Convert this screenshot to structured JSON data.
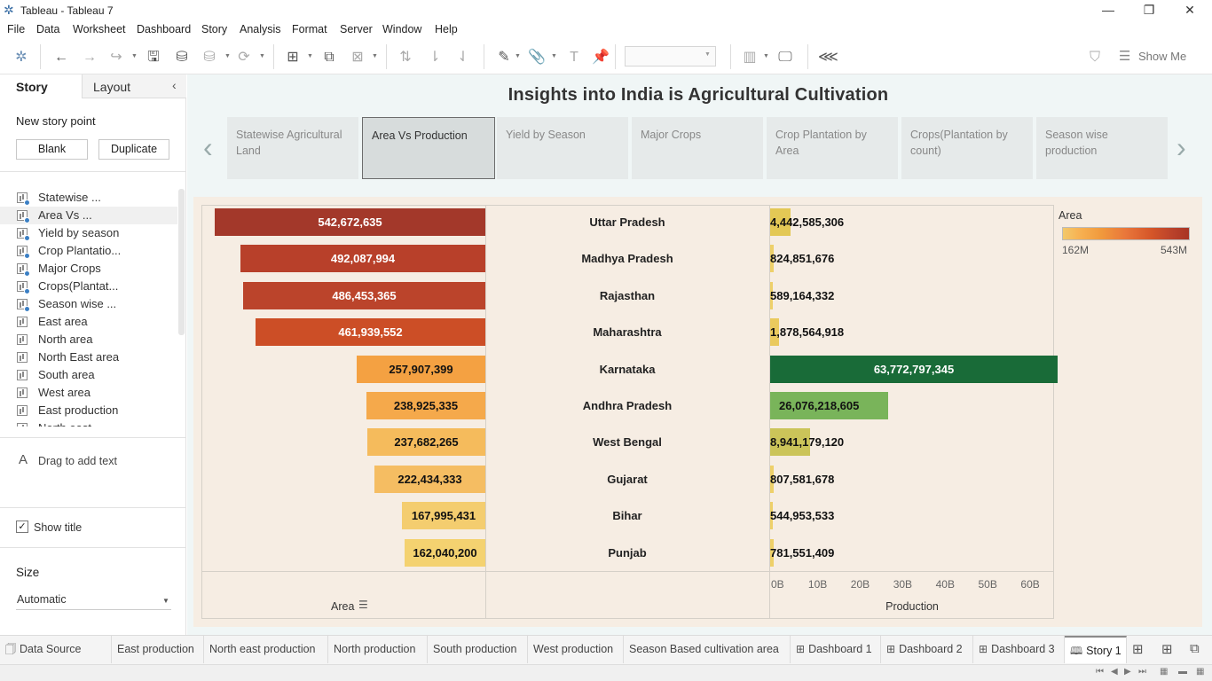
{
  "window": {
    "title": "Tableau - Tableau 7",
    "minimize": "—",
    "maximize": "❐",
    "close": "✕"
  },
  "menu": [
    "File",
    "Data",
    "Worksheet",
    "Dashboard",
    "Story",
    "Analysis",
    "Format",
    "Server",
    "Window",
    "Help"
  ],
  "toolbar": {
    "show_me": "Show Me"
  },
  "sidebar": {
    "tab_story": "Story",
    "tab_layout": "Layout",
    "new_story_point": "New story point",
    "blank_button": "Blank",
    "duplicate_button": "Duplicate",
    "sheets": [
      {
        "label": "Statewise ...",
        "used": true
      },
      {
        "label": "Area Vs ...",
        "used": true
      },
      {
        "label": "Yield by season",
        "used": true
      },
      {
        "label": "Crop Plantatio...",
        "used": true
      },
      {
        "label": "Major Crops",
        "used": true
      },
      {
        "label": "Crops(Plantat...",
        "used": true
      },
      {
        "label": "Season wise ...",
        "used": true
      },
      {
        "label": "East area",
        "used": false
      },
      {
        "label": "North area",
        "used": false
      },
      {
        "label": "North East area",
        "used": false
      },
      {
        "label": "South area",
        "used": false
      },
      {
        "label": "West area",
        "used": false
      },
      {
        "label": "East production",
        "used": false
      },
      {
        "label": "North east ...",
        "used": false
      }
    ],
    "drag_text": "Drag to add text",
    "show_title": "Show title",
    "size_heading": "Size",
    "size_value": "Automatic"
  },
  "story": {
    "title": "Insights into India is Agricultural Cultivation",
    "points": [
      "Statewise Agricultural Land",
      "Area Vs Production",
      "Yield by Season",
      "Major Crops",
      "Crop Plantation by Area",
      "Crops(Plantation by count)",
      "Season wise production"
    ],
    "active_index": 1
  },
  "chart_data": {
    "type": "bar",
    "categories": [
      "Uttar Pradesh",
      "Madhya Pradesh",
      "Rajasthan",
      "Maharashtra",
      "Karnataka",
      "Andhra Pradesh",
      "West Bengal",
      "Gujarat",
      "Bihar",
      "Punjab"
    ],
    "series": [
      {
        "name": "Area",
        "values": [
          542672635,
          492087994,
          486453365,
          461939552,
          257907399,
          238925335,
          237682265,
          222434333,
          167995431,
          162040200
        ],
        "labels": [
          "542,672,635",
          "492,087,994",
          "486,453,365",
          "461,939,552",
          "257,907,399",
          "238,925,335",
          "237,682,265",
          "222,434,333",
          "167,995,431",
          "162,040,200"
        ]
      },
      {
        "name": "Production",
        "values": [
          4442585306,
          824851676,
          589164332,
          1878564918,
          63772797345,
          26076218605,
          8941179120,
          807581678,
          544953533,
          781551409
        ],
        "labels": [
          "4,442,585,306",
          "824,851,676",
          "589,164,332",
          "1,878,564,918",
          "63,772,797,345",
          "26,076,218,605",
          "8,941,179,120",
          "807,581,678",
          "544,953,533",
          "781,551,409"
        ]
      }
    ],
    "area_colors": [
      "#a3382a",
      "#b8402a",
      "#bb442b",
      "#cc4e26",
      "#f4a142",
      "#f5a94b",
      "#f5bb5c",
      "#f5bd62",
      "#f4cd6f",
      "#f4d270"
    ],
    "production_colors": [
      "#e3c855",
      "#eed069",
      "#eed069",
      "#eaca5d",
      "#196b38",
      "#79b45a",
      "#cbc459",
      "#eed069",
      "#eed069",
      "#eed069"
    ],
    "xlabel_area": "Area",
    "xlabel_production": "Production",
    "production_ticks": [
      "0B",
      "10B",
      "20B",
      "30B",
      "40B",
      "50B",
      "60B"
    ],
    "area_xlim": [
      0,
      570000000
    ],
    "production_xlim": [
      0,
      64000000000
    ],
    "legend": {
      "title": "Area",
      "min": "162M",
      "max": "543M",
      "position": "top-right"
    }
  },
  "bottom_tabs": [
    {
      "label": "Data Source",
      "icon": "🗍"
    },
    {
      "label": "East production",
      "icon": ""
    },
    {
      "label": "North east production",
      "icon": ""
    },
    {
      "label": "North production",
      "icon": ""
    },
    {
      "label": "South production",
      "icon": ""
    },
    {
      "label": "West production",
      "icon": ""
    },
    {
      "label": "Season Based cultivation area",
      "icon": ""
    },
    {
      "label": "Dashboard 1",
      "icon": "⊞"
    },
    {
      "label": "Dashboard 2",
      "icon": "⊞"
    },
    {
      "label": "Dashboard 3",
      "icon": "⊞"
    },
    {
      "label": "Story 1",
      "icon": "🕮"
    }
  ]
}
